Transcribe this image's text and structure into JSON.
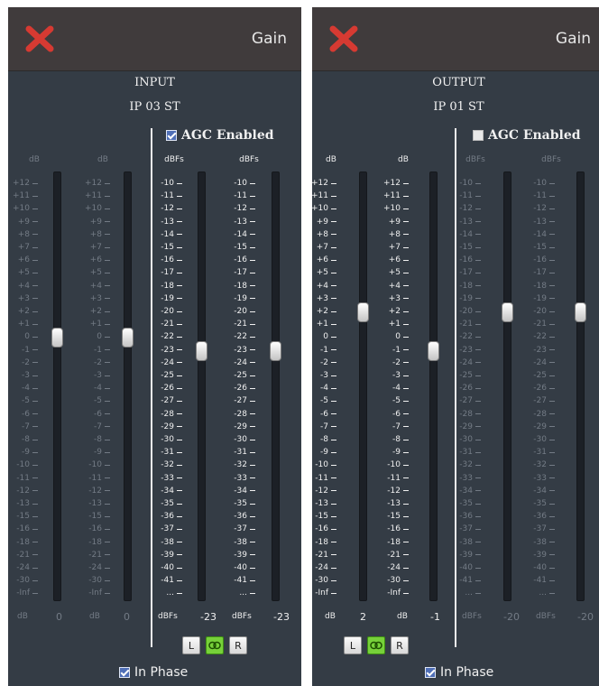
{
  "colors": {
    "panel": "#343c45",
    "titlebar": "#403b3c",
    "enabled_text": "#f0f0f0",
    "disabled_text": "#737b85",
    "close_red": "#d63a32",
    "link_green": "#77d13a"
  },
  "input_panel": {
    "title": "Gain",
    "section": "INPUT",
    "source": "IP 03 ST",
    "agc_label": "AGC Enabled",
    "agc_checked": true,
    "columns": [
      {
        "header": "dB",
        "unit": "dB",
        "value": "0",
        "active": false,
        "level": 0
      },
      {
        "header": "dB",
        "unit": "dB",
        "value": "0",
        "active": false,
        "level": 0
      },
      {
        "header": "dBFs",
        "unit": "dBFs",
        "value": "-23",
        "active": true,
        "level": -23
      },
      {
        "header": "dBFs",
        "unit": "dBFs",
        "value": "-23",
        "active": true,
        "level": -23
      }
    ],
    "buttons": {
      "left": "L",
      "link": "link",
      "right": "R"
    },
    "phase_label": "In Phase",
    "phase_checked": true
  },
  "output_panel": {
    "title": "Gain",
    "section": "OUTPUT",
    "source": "IP 01 ST",
    "agc_label": "AGC Enabled",
    "agc_checked": false,
    "columns": [
      {
        "header": "dB",
        "unit": "dB",
        "value": "2",
        "active": true,
        "level": 2
      },
      {
        "header": "dB",
        "unit": "dB",
        "value": "-1",
        "active": true,
        "level": -1
      },
      {
        "header": "dBFs",
        "unit": "dBFs",
        "value": "-20",
        "active": false,
        "level": -20
      },
      {
        "header": "dBFs",
        "unit": "dBFs",
        "value": "-20",
        "active": false,
        "level": -20
      }
    ],
    "buttons": {
      "left": "L",
      "link": "link",
      "right": "R"
    },
    "phase_label": "In Phase",
    "phase_checked": true
  },
  "scales": {
    "db": [
      "+12",
      "+11",
      "+10",
      "+9",
      "+8",
      "+7",
      "+6",
      "+5",
      "+4",
      "+3",
      "+2",
      "+1",
      "0",
      "-1",
      "-2",
      "-3",
      "-4",
      "-5",
      "-6",
      "-7",
      "-8",
      "-9",
      "-10",
      "-11",
      "-12",
      "-13",
      "-15",
      "-16",
      "-18",
      "-21",
      "-24",
      "-30",
      "-Inf"
    ],
    "dbfs": [
      "-10",
      "-11",
      "-12",
      "-13",
      "-14",
      "-15",
      "-16",
      "-17",
      "-18",
      "-19",
      "-20",
      "-21",
      "-22",
      "-23",
      "-24",
      "-25",
      "-26",
      "-27",
      "-28",
      "-29",
      "-30",
      "-31",
      "-32",
      "-33",
      "-34",
      "-35",
      "-36",
      "-37",
      "-38",
      "-39",
      "-40",
      "-41",
      "..."
    ]
  }
}
